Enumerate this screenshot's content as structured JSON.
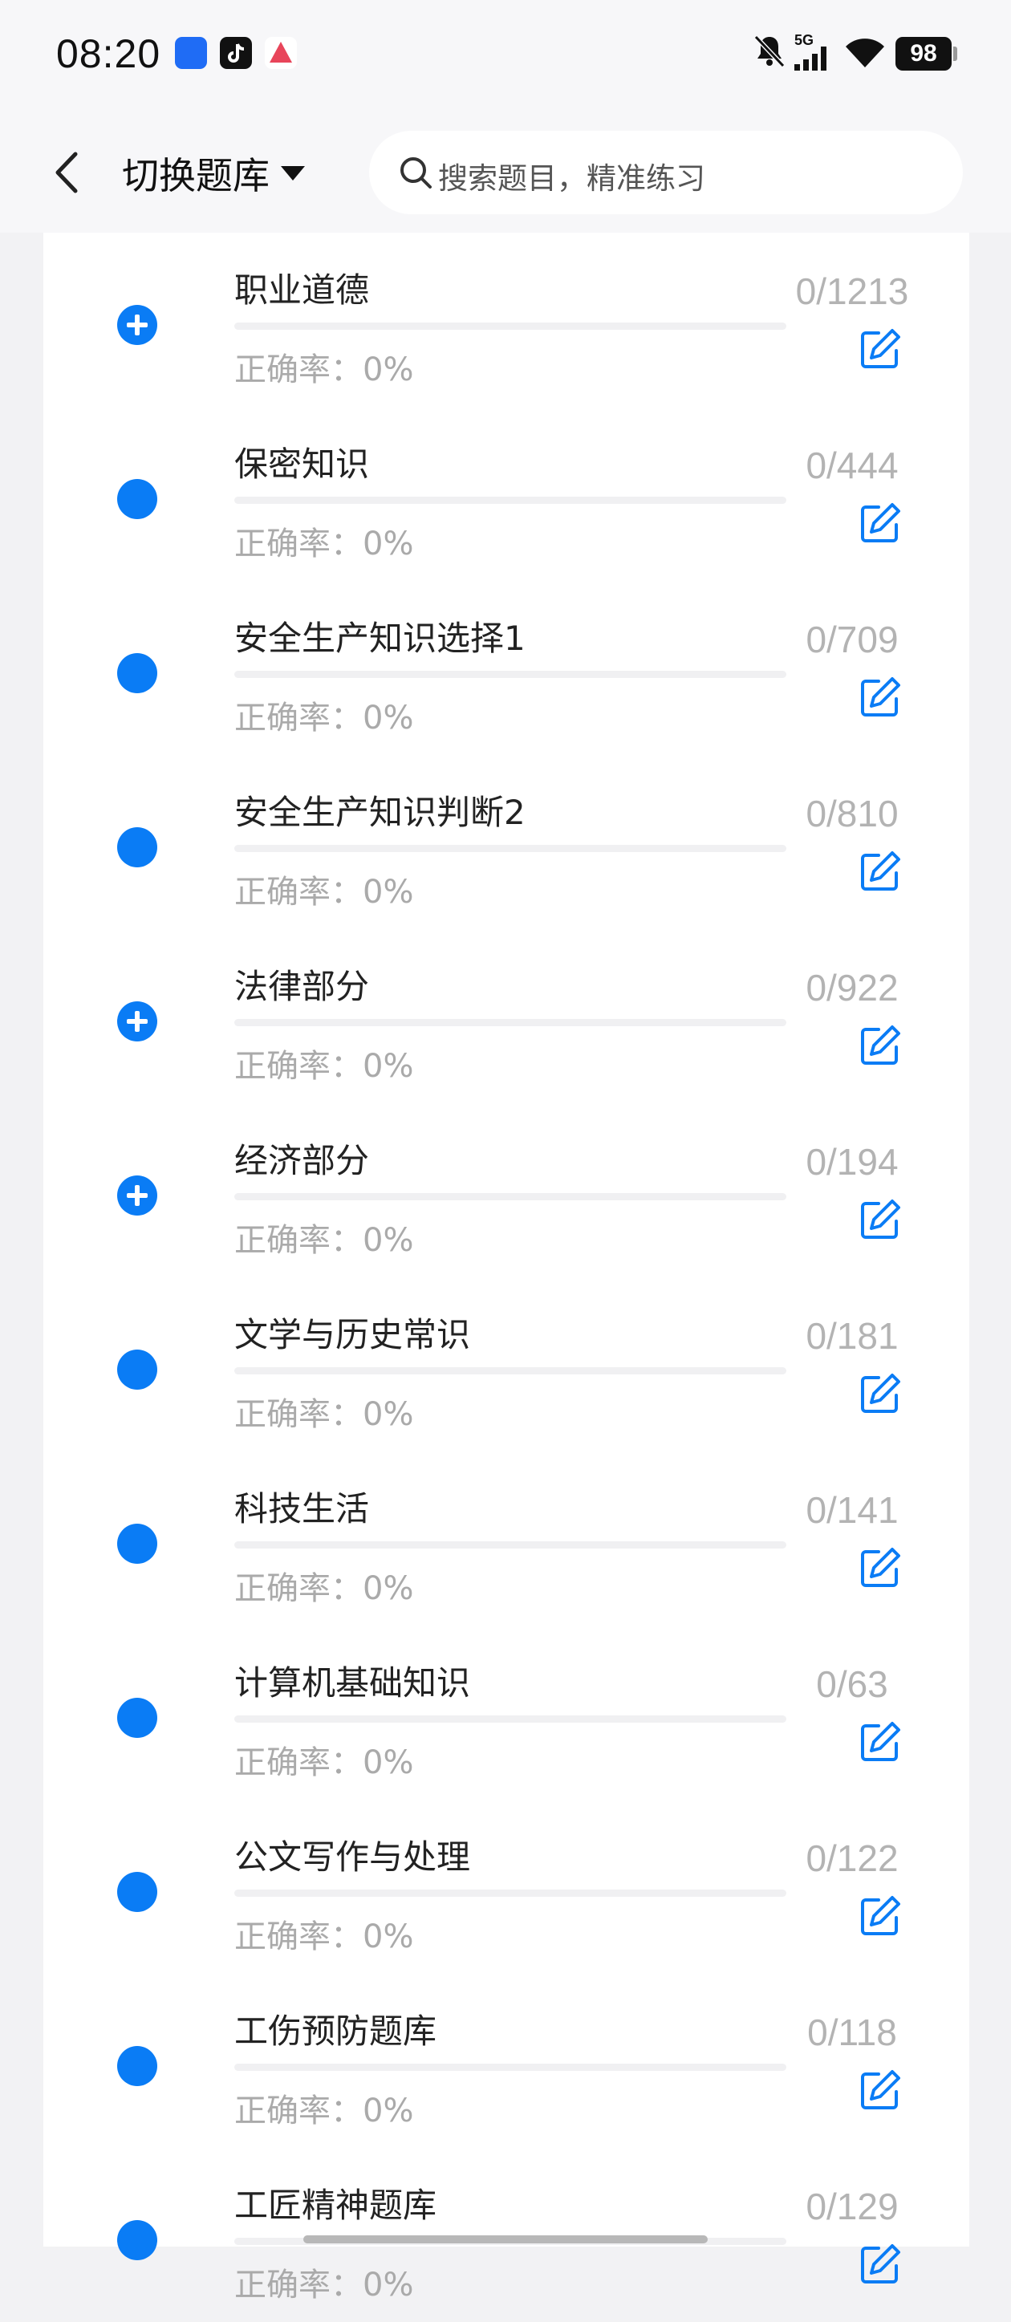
{
  "status_bar": {
    "time": "08:20",
    "network": "5G",
    "battery": "98"
  },
  "header": {
    "switch_label": "切换题库",
    "search_placeholder": "搜索题目，精准练习"
  },
  "colors": {
    "accent": "#0a7cf5",
    "muted": "#b3b3b3"
  },
  "categories": [
    {
      "name": "职业道德",
      "accuracy": "正确率：0%",
      "count": "0/1213",
      "icon": "plus-circle-icon",
      "progress": 0
    },
    {
      "name": "保密知识",
      "accuracy": "正确率：0%",
      "count": "0/444",
      "icon": "dot-icon",
      "progress": 0
    },
    {
      "name": "安全生产知识选择1",
      "accuracy": "正确率：0%",
      "count": "0/709",
      "icon": "dot-icon",
      "progress": 0
    },
    {
      "name": "安全生产知识判断2",
      "accuracy": "正确率：0%",
      "count": "0/810",
      "icon": "dot-icon",
      "progress": 0
    },
    {
      "name": "法律部分",
      "accuracy": "正确率：0%",
      "count": "0/922",
      "icon": "plus-circle-icon",
      "progress": 0
    },
    {
      "name": "经济部分",
      "accuracy": "正确率：0%",
      "count": "0/194",
      "icon": "plus-circle-icon",
      "progress": 0
    },
    {
      "name": "文学与历史常识",
      "accuracy": "正确率：0%",
      "count": "0/181",
      "icon": "dot-icon",
      "progress": 0
    },
    {
      "name": "科技生活",
      "accuracy": "正确率：0%",
      "count": "0/141",
      "icon": "dot-icon",
      "progress": 0
    },
    {
      "name": "计算机基础知识",
      "accuracy": "正确率：0%",
      "count": "0/63",
      "icon": "dot-icon",
      "progress": 0
    },
    {
      "name": "公文写作与处理",
      "accuracy": "正确率：0%",
      "count": "0/122",
      "icon": "dot-icon",
      "progress": 0
    },
    {
      "name": "工伤预防题库",
      "accuracy": "正确率：0%",
      "count": "0/118",
      "icon": "dot-icon",
      "progress": 0
    },
    {
      "name": "工匠精神题库",
      "accuracy": "正确率：0%",
      "count": "0/129",
      "icon": "dot-icon",
      "progress": 0
    }
  ]
}
